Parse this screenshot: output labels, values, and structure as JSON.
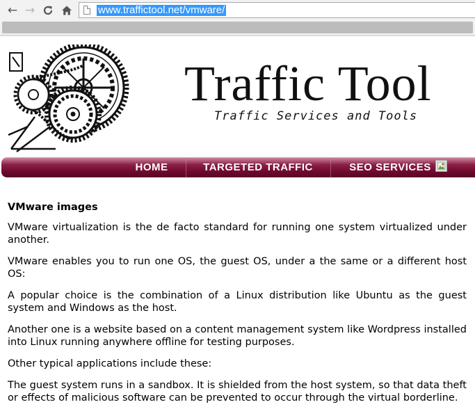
{
  "browser": {
    "url": "www.traffictool.net/vmware/",
    "buttons": {
      "back": "back-arrow-icon",
      "forward": "forward-arrow-icon",
      "reload": "reload-icon",
      "home": "home-icon"
    }
  },
  "site": {
    "title": "Traffic Tool",
    "subtitle": "Traffic Services and Tools",
    "logo": "gears-illustration"
  },
  "nav": {
    "items": [
      {
        "label": "HOME"
      },
      {
        "label": "TARGETED TRAFFIC"
      },
      {
        "label": "SEO SERVICES"
      }
    ],
    "colors": {
      "top": "#c9859a",
      "mid": "#8c1f45",
      "bottom": "#5a0424"
    }
  },
  "content": {
    "heading": "VMware images",
    "paragraphs": [
      "VMware virtualization is the de facto standard for running one system virtualized under another.",
      "VMware enables you to run one OS, the guest OS, under a the same or a different host OS:",
      "A popular choice is the combination of a Linux distribution like Ubuntu as the guest system and Windows as the host.",
      "Another one is a website based on a content management system like Wordpress installed into Linux running anywhere offline for testing purposes.",
      "Other typical applications include these:",
      "The guest system runs in a sandbox. It is shielded from the host system, so that data theft or effects of malicious software can be prevented to occur through the virtual borderline."
    ]
  }
}
